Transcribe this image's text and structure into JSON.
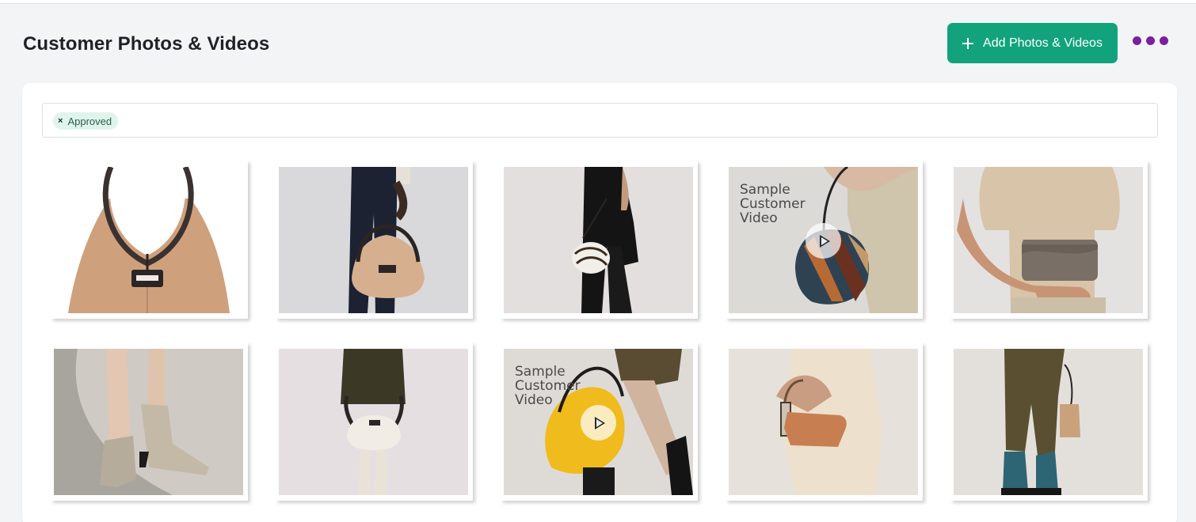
{
  "page": {
    "title": "Customer Photos & Videos"
  },
  "toolbar": {
    "add_label": "Add Photos & Videos",
    "more_icon": "more-dots-icon",
    "accent": "#12a37c",
    "more_color": "#7a1fa2"
  },
  "filters": [
    {
      "label": "Approved",
      "remove_icon": "close-icon",
      "remove_glyph": "×"
    }
  ],
  "media": [
    {
      "type": "photo",
      "subject": "tan hobo bag close-up"
    },
    {
      "type": "photo",
      "subject": "tan hobo bag carried by model"
    },
    {
      "type": "photo",
      "subject": "white swirl pouch bag"
    },
    {
      "type": "video",
      "subject": "striped bucket bag",
      "overlay_text": "Sample\nCustomer\nVideo",
      "play_icon": "play-icon"
    },
    {
      "type": "photo",
      "subject": "grey flap clutch"
    },
    {
      "type": "photo",
      "subject": "ankle boots on pavement"
    },
    {
      "type": "photo",
      "subject": "cream hobo bag held in front"
    },
    {
      "type": "video",
      "subject": "yellow hobo bag",
      "overlay_text": "Sample\nCustomer\nVideo",
      "play_icon": "play-icon"
    },
    {
      "type": "photo",
      "subject": "cognac shoulder bag"
    },
    {
      "type": "photo",
      "subject": "tan tote with leather trousers"
    }
  ]
}
